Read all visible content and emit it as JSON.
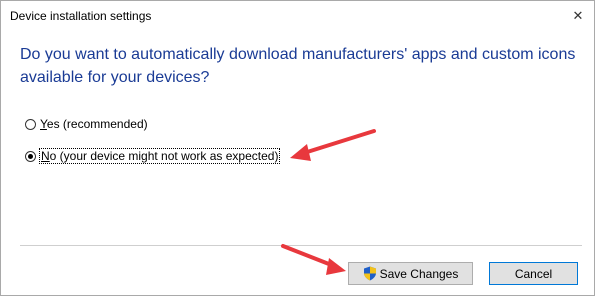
{
  "window": {
    "title": "Device installation settings",
    "close_glyph": "✕"
  },
  "question": "Do you want to automatically download manufacturers' apps and custom icons available for your devices?",
  "options": [
    {
      "mnemonic": "Y",
      "rest": "es (recommended)",
      "checked": false
    },
    {
      "mnemonic": "N",
      "rest": "o (your device might not work as expected)",
      "checked": true
    }
  ],
  "buttons": {
    "save_label": "Save Changes",
    "cancel_label": "Cancel"
  },
  "icons": {
    "save_button_icon": "uac-shield-icon",
    "close": "close-icon",
    "annotation": "red-arrow-icon"
  },
  "colors": {
    "question_text": "#1a3b95",
    "annotation_arrow": "#e8383d",
    "button_face": "#e1e1e1",
    "cancel_focus_border": "#0078d7"
  }
}
